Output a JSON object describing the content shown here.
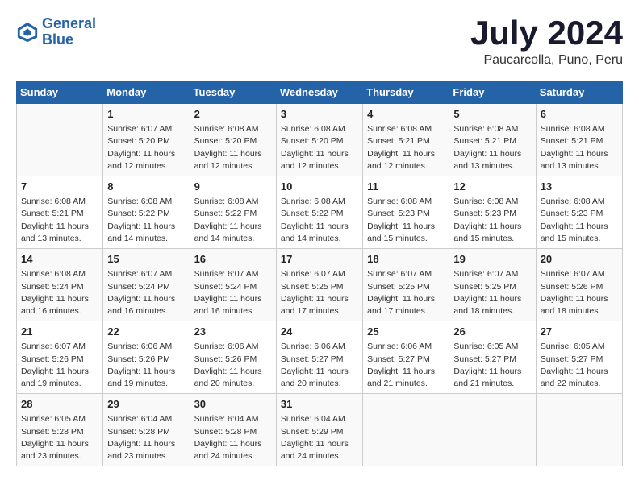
{
  "logo": {
    "line1": "General",
    "line2": "Blue"
  },
  "title": "July 2024",
  "location": "Paucarcolla, Puno, Peru",
  "days_of_week": [
    "Sunday",
    "Monday",
    "Tuesday",
    "Wednesday",
    "Thursday",
    "Friday",
    "Saturday"
  ],
  "weeks": [
    [
      {
        "day": "",
        "info": ""
      },
      {
        "day": "1",
        "info": "Sunrise: 6:07 AM\nSunset: 5:20 PM\nDaylight: 11 hours\nand 12 minutes."
      },
      {
        "day": "2",
        "info": "Sunrise: 6:08 AM\nSunset: 5:20 PM\nDaylight: 11 hours\nand 12 minutes."
      },
      {
        "day": "3",
        "info": "Sunrise: 6:08 AM\nSunset: 5:20 PM\nDaylight: 11 hours\nand 12 minutes."
      },
      {
        "day": "4",
        "info": "Sunrise: 6:08 AM\nSunset: 5:21 PM\nDaylight: 11 hours\nand 12 minutes."
      },
      {
        "day": "5",
        "info": "Sunrise: 6:08 AM\nSunset: 5:21 PM\nDaylight: 11 hours\nand 13 minutes."
      },
      {
        "day": "6",
        "info": "Sunrise: 6:08 AM\nSunset: 5:21 PM\nDaylight: 11 hours\nand 13 minutes."
      }
    ],
    [
      {
        "day": "7",
        "info": "Sunrise: 6:08 AM\nSunset: 5:21 PM\nDaylight: 11 hours\nand 13 minutes."
      },
      {
        "day": "8",
        "info": "Sunrise: 6:08 AM\nSunset: 5:22 PM\nDaylight: 11 hours\nand 14 minutes."
      },
      {
        "day": "9",
        "info": "Sunrise: 6:08 AM\nSunset: 5:22 PM\nDaylight: 11 hours\nand 14 minutes."
      },
      {
        "day": "10",
        "info": "Sunrise: 6:08 AM\nSunset: 5:22 PM\nDaylight: 11 hours\nand 14 minutes."
      },
      {
        "day": "11",
        "info": "Sunrise: 6:08 AM\nSunset: 5:23 PM\nDaylight: 11 hours\nand 15 minutes."
      },
      {
        "day": "12",
        "info": "Sunrise: 6:08 AM\nSunset: 5:23 PM\nDaylight: 11 hours\nand 15 minutes."
      },
      {
        "day": "13",
        "info": "Sunrise: 6:08 AM\nSunset: 5:23 PM\nDaylight: 11 hours\nand 15 minutes."
      }
    ],
    [
      {
        "day": "14",
        "info": "Sunrise: 6:08 AM\nSunset: 5:24 PM\nDaylight: 11 hours\nand 16 minutes."
      },
      {
        "day": "15",
        "info": "Sunrise: 6:07 AM\nSunset: 5:24 PM\nDaylight: 11 hours\nand 16 minutes."
      },
      {
        "day": "16",
        "info": "Sunrise: 6:07 AM\nSunset: 5:24 PM\nDaylight: 11 hours\nand 16 minutes."
      },
      {
        "day": "17",
        "info": "Sunrise: 6:07 AM\nSunset: 5:25 PM\nDaylight: 11 hours\nand 17 minutes."
      },
      {
        "day": "18",
        "info": "Sunrise: 6:07 AM\nSunset: 5:25 PM\nDaylight: 11 hours\nand 17 minutes."
      },
      {
        "day": "19",
        "info": "Sunrise: 6:07 AM\nSunset: 5:25 PM\nDaylight: 11 hours\nand 18 minutes."
      },
      {
        "day": "20",
        "info": "Sunrise: 6:07 AM\nSunset: 5:26 PM\nDaylight: 11 hours\nand 18 minutes."
      }
    ],
    [
      {
        "day": "21",
        "info": "Sunrise: 6:07 AM\nSunset: 5:26 PM\nDaylight: 11 hours\nand 19 minutes."
      },
      {
        "day": "22",
        "info": "Sunrise: 6:06 AM\nSunset: 5:26 PM\nDaylight: 11 hours\nand 19 minutes."
      },
      {
        "day": "23",
        "info": "Sunrise: 6:06 AM\nSunset: 5:26 PM\nDaylight: 11 hours\nand 20 minutes."
      },
      {
        "day": "24",
        "info": "Sunrise: 6:06 AM\nSunset: 5:27 PM\nDaylight: 11 hours\nand 20 minutes."
      },
      {
        "day": "25",
        "info": "Sunrise: 6:06 AM\nSunset: 5:27 PM\nDaylight: 11 hours\nand 21 minutes."
      },
      {
        "day": "26",
        "info": "Sunrise: 6:05 AM\nSunset: 5:27 PM\nDaylight: 11 hours\nand 21 minutes."
      },
      {
        "day": "27",
        "info": "Sunrise: 6:05 AM\nSunset: 5:27 PM\nDaylight: 11 hours\nand 22 minutes."
      }
    ],
    [
      {
        "day": "28",
        "info": "Sunrise: 6:05 AM\nSunset: 5:28 PM\nDaylight: 11 hours\nand 23 minutes."
      },
      {
        "day": "29",
        "info": "Sunrise: 6:04 AM\nSunset: 5:28 PM\nDaylight: 11 hours\nand 23 minutes."
      },
      {
        "day": "30",
        "info": "Sunrise: 6:04 AM\nSunset: 5:28 PM\nDaylight: 11 hours\nand 24 minutes."
      },
      {
        "day": "31",
        "info": "Sunrise: 6:04 AM\nSunset: 5:29 PM\nDaylight: 11 hours\nand 24 minutes."
      },
      {
        "day": "",
        "info": ""
      },
      {
        "day": "",
        "info": ""
      },
      {
        "day": "",
        "info": ""
      }
    ]
  ]
}
